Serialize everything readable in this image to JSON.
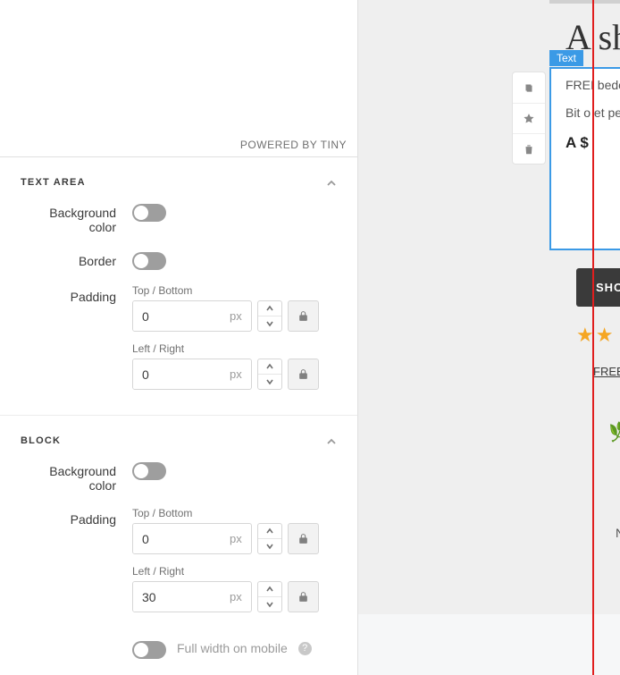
{
  "tiny_credit": "POWERED BY TINY",
  "sections": {
    "text_area": {
      "title": "TEXT AREA",
      "bg_label": "Background color",
      "border_label": "Border",
      "padding_label": "Padding",
      "tb_label": "Top / Bottom",
      "lr_label": "Left / Right",
      "tb_value": "0",
      "lr_value": "0",
      "unit": "px"
    },
    "block": {
      "title": "BLOCK",
      "bg_label": "Background color",
      "padding_label": "Padding",
      "tb_label": "Top / Bottom",
      "lr_label": "Left / Right",
      "tb_value": "0",
      "lr_value": "30",
      "unit": "px",
      "fullw_label": "Full width on mobile"
    }
  },
  "canvas": {
    "text_tag": "Text",
    "heading": "A sh",
    "para1": "FREI bede",
    "para2": "Bit o et pe taspi im n ditat",
    "price": "A $",
    "cta": "SHO",
    "stars": "★★",
    "link": "FREE",
    "n": "N"
  }
}
